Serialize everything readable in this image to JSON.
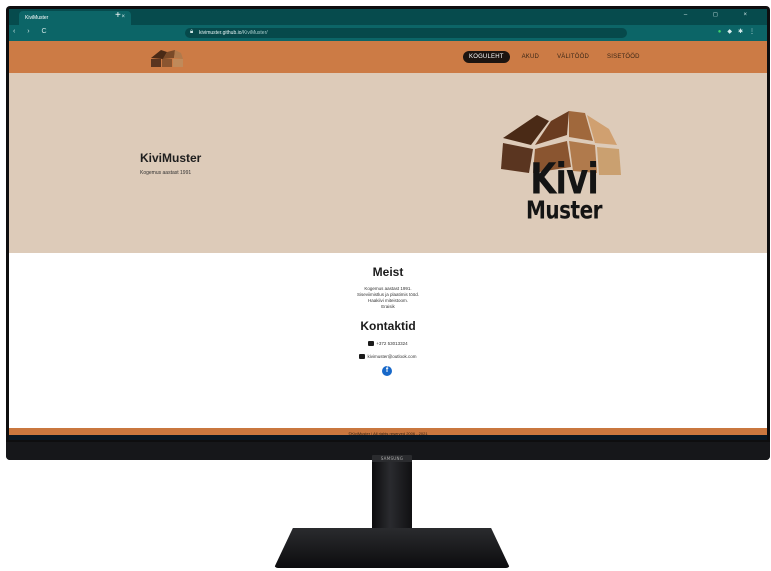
{
  "browser": {
    "tab_title": "KiviMuster",
    "tab_close": "×",
    "new_tab": "+",
    "url_host": "kivimuster.github.io",
    "url_path": "/KiviMuster/",
    "nav_glyphs": "‹ › C",
    "window_controls": "– ◻ ×"
  },
  "site": {
    "nav": {
      "items": [
        "KOGULEHT",
        "AKUD",
        "VÄLITÖÖD",
        "SISETÖÖD"
      ],
      "active_index": 0
    },
    "hero": {
      "title": "KiviMuster",
      "subtitle": "Kogemus aastast 1991",
      "logo_word_1": "Kivi",
      "logo_word_2": "Muster"
    },
    "about": {
      "heading": "Meist",
      "lines": [
        "Kogemus aastast 1991.",
        "Siseviimistlus ja plaatimis tööd.",
        "Haakiivi miteistoom.",
        "Eraisik"
      ]
    },
    "contacts": {
      "heading": "Kontaktid",
      "phone": "+372 53013324",
      "email": "kivimuster@outlook.com",
      "facebook_glyph": "f"
    },
    "footer": "©KiviMuster | All rights reserved 2006 - 2021"
  },
  "monitor": {
    "brand": "SAMSUNG"
  },
  "colors": {
    "nav_bg": "#cc7b45",
    "hero_bg": "#ddcbb9",
    "browser_teal": "#0c6567"
  }
}
